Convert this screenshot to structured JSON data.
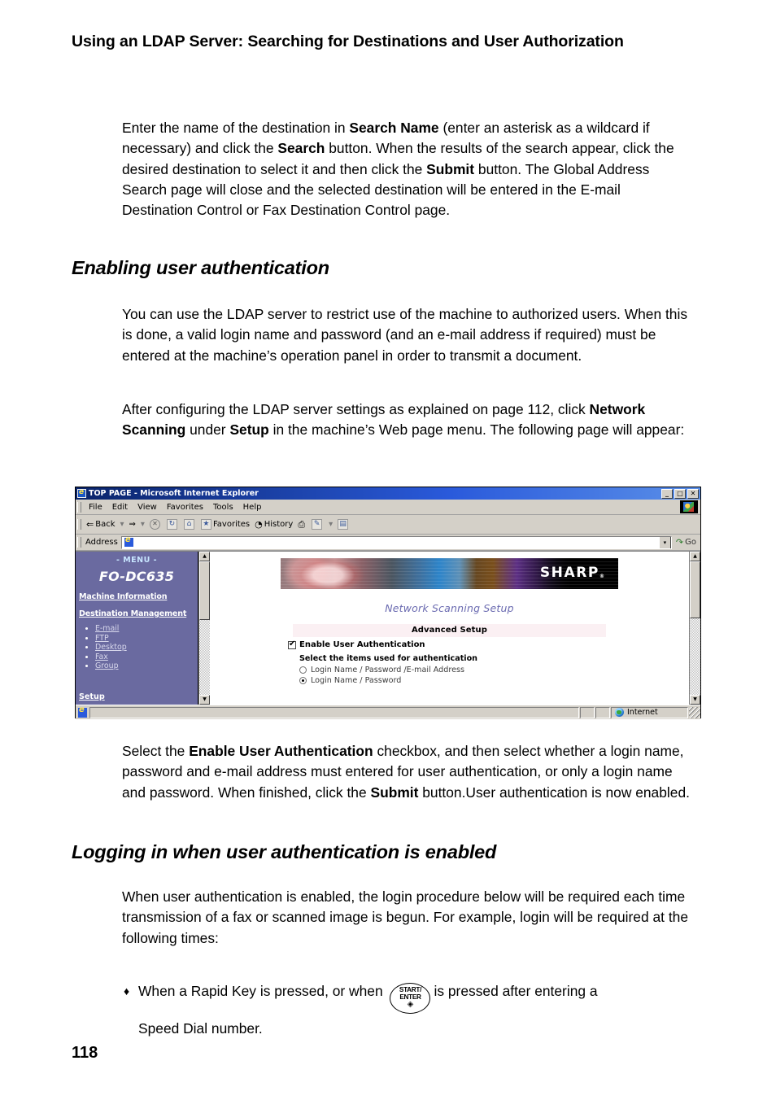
{
  "document": {
    "running_head": "Using an LDAP Server: Searching for Destinations and User Authorization",
    "page_number": "118"
  },
  "paragraphs": {
    "intro": {
      "p1": "Enter the name of the destination in ",
      "b1": "Search Name",
      "p2": " (enter an asterisk as a wildcard if necessary) and click the ",
      "b2": "Search",
      "p3": " button. When the results of the search appear, click the desired destination to select it and then click the ",
      "b3": "Submit",
      "p4": " button. The Global Address Search page will close and the selected destination will be entered in the E-mail Destination Control or Fax Destination Control page."
    },
    "enabling": {
      "heading": "Enabling user authentication",
      "body": "You can use the LDAP server to restrict use of the machine to authorized users. When this is done, a valid login name and password (and an e-mail address if required) must be entered at the machine’s operation panel in order to transmit a document.",
      "after_p1": "After configuring the LDAP server settings as explained on page 112, click ",
      "after_b1": "Network Scanning",
      "after_p2": " under ",
      "after_b2": "Setup",
      "after_p3": " in the machine’s Web page menu. The following page will appear:"
    },
    "after_figure": {
      "p1": "Select the ",
      "b1": "Enable User Authentication",
      "p2": " checkbox, and then select whether  a login name, password and e-mail address must entered for user authentication, or only a login name and password. When finished, click the ",
      "b2": "Submit",
      "p3": " button.User authentication is now enabled."
    },
    "logging_in": {
      "heading": "Logging in when user authentication is enabled",
      "body": "When user authentication is enabled, the login procedure below will be required each time transmission of a fax or scanned image is begun. For example, login will be required at the following times:"
    }
  },
  "bullet": {
    "marker": "♦",
    "text_before": "When a Rapid Key is pressed, or when",
    "key_line1": "START/",
    "key_line2": "ENTER",
    "key_glyph": "◈",
    "text_after": "is pressed after entering a",
    "text_second_line": "Speed Dial number."
  },
  "browser": {
    "title": "TOP PAGE - Microsoft Internet Explorer",
    "window_buttons": {
      "minimize": "_",
      "maximize": "□",
      "close": "✕"
    },
    "menus": [
      "File",
      "Edit",
      "View",
      "Favorites",
      "Tools",
      "Help"
    ],
    "toolbar": [
      {
        "name": "back",
        "glyph": "⇐",
        "label": "Back",
        "enabled": true
      },
      {
        "name": "back-dropdown",
        "glyph": "▾",
        "label": "",
        "enabled": true
      },
      {
        "name": "forward",
        "glyph": "⇒",
        "label": "",
        "enabled": true
      },
      {
        "name": "forward-dropdown",
        "glyph": "▾",
        "label": "",
        "enabled": false
      },
      {
        "name": "stop",
        "glyph": "✕",
        "label": "",
        "enabled": false
      },
      {
        "name": "refresh",
        "glyph": "↻",
        "label": "",
        "enabled": true
      },
      {
        "name": "home",
        "glyph": "⌂",
        "label": "",
        "enabled": true
      },
      {
        "name": "favorites",
        "glyph": "★",
        "label": "Favorites",
        "enabled": true
      },
      {
        "name": "history",
        "glyph": "◔",
        "label": "History",
        "enabled": true
      },
      {
        "name": "print",
        "glyph": "⎙",
        "label": "",
        "enabled": true
      },
      {
        "name": "edit",
        "glyph": "✎",
        "label": "",
        "enabled": true
      },
      {
        "name": "edit-dropdown",
        "glyph": "▾",
        "label": "",
        "enabled": true
      },
      {
        "name": "messenger",
        "glyph": "▤",
        "label": "",
        "enabled": true
      }
    ],
    "address": {
      "label": "Address",
      "value": "",
      "dropdown_glyph": "▾",
      "go_label": "Go"
    },
    "status": {
      "message": "",
      "zone": "Internet"
    }
  },
  "webpage": {
    "sidebar": {
      "menu_title": "- MENU -",
      "model": "FO-DC635",
      "links": [
        {
          "label": "Machine Information"
        },
        {
          "label": "Destination Management"
        }
      ],
      "sub_links": [
        "E-mail",
        "FTP",
        "Desktop",
        "Fax",
        "Group"
      ],
      "setup": "Setup"
    },
    "main": {
      "brand": "SHARP",
      "brand_mark": "®",
      "title": "Network Scanning Setup",
      "section_bar": "Advanced Setup",
      "checkbox_label": "Enable User Authentication",
      "checkbox_checked": true,
      "sub_heading": "Select the items used for authentication",
      "radios": [
        {
          "label": "Login Name / Password /E-mail Address",
          "selected": false
        },
        {
          "label": "Login Name / Password",
          "selected": true
        }
      ]
    }
  },
  "colors": {
    "titlebar_blue": "#0a246a",
    "sidebar_purple": "#6a6aa0",
    "page_title_purple": "#6a6ab0",
    "section_bar_pink": "#fbf0f3",
    "chrome_gray": "#d4d0c8"
  }
}
